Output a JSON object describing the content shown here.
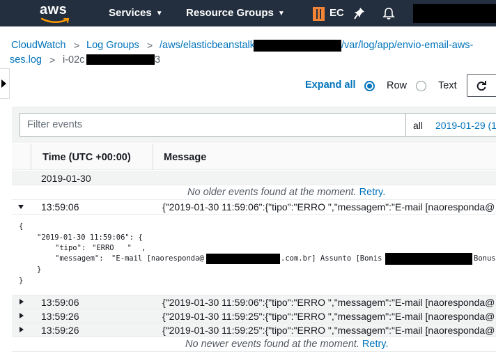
{
  "nav": {
    "logo": "aws",
    "services": "Services",
    "resource_groups": "Resource Groups",
    "ec_label": "EC",
    "pin_icon": "pin-icon",
    "bell_icon": "bell-icon"
  },
  "breadcrumb": {
    "cloudwatch": "CloudWatch",
    "log_groups": "Log Groups",
    "group_prefix": "/aws/elasticbeanstalk",
    "group_suffix": "/var/log/app/envio-email-aws-",
    "group_line2": "ses.log",
    "stream_prefix": "i-02c",
    "stream_suffix": "3"
  },
  "toolbar": {
    "expand_all": "Expand all",
    "row_label": "Row",
    "text_label": "Text",
    "selected_view": "Row"
  },
  "filter": {
    "placeholder": "Filter events",
    "range_all": "all",
    "range_date": "2019-01-29 (1"
  },
  "table": {
    "col_time": "Time (UTC +00:00)",
    "col_message": "Message",
    "date_group": "2019-01-30",
    "no_older": "No older events found at the moment.",
    "no_newer": "No newer events found at the moment.",
    "retry": "Retry.",
    "expanded_row": {
      "time": "13:59:06",
      "message": "{\"2019-01-30 11:59:06\":{\"tipo\":\"ERRO \",\"messagem\":\"E-mail [naoresponda@"
    },
    "json": {
      "open": "{",
      "key_line": "\"2019-01-30 11:59:06\": {",
      "tipo_key": "\"tipo\": ",
      "tipo_val": "\"ERRO   \"",
      "tipo_comma": ",",
      "msg_key": "\"messagem\": ",
      "msg_val_1": "\"E-mail [naoresponda@",
      "msg_val_2": ".com.br] Assunto [Bonis",
      "msg_val_3": "Bonus",
      "inner_close": "}",
      "close": "}"
    },
    "rows": [
      {
        "time": "13:59:06",
        "message": "{\"2019-01-30 11:59:06\":{\"tipo\":\"ERRO \",\"messagem\":\"E-mail [naoresponda@"
      },
      {
        "time": "13:59:26",
        "message": "{\"2019-01-30 11:59:25\":{\"tipo\":\"ERRO \",\"messagem\":\"E-mail [naoresponda@"
      },
      {
        "time": "13:59:26",
        "message": "{\"2019-01-30 11:59:25\":{\"tipo\":\"ERRO \",\"messagem\":\"E-mail [naoresponda@"
      }
    ]
  },
  "colors": {
    "nav_bg": "#232f3e",
    "link": "#0073bb",
    "json_string": "#1d8102",
    "ec_icon": "#f58536"
  }
}
